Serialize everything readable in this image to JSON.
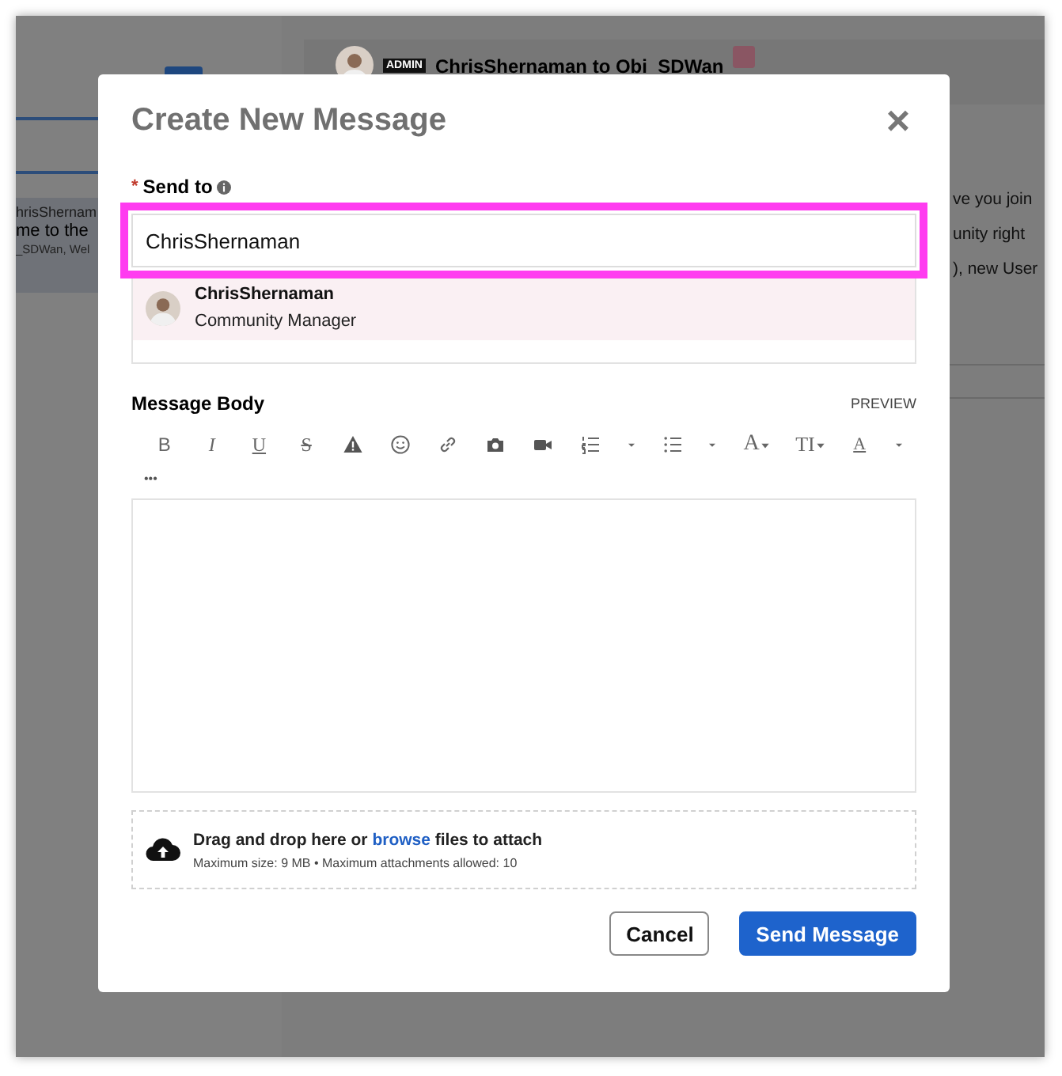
{
  "background": {
    "left_panel": {
      "row_lines": [
        "hrisShernam",
        "me to the",
        "_SDWan, Wel"
      ]
    },
    "conversation": {
      "badge": "ADMIN",
      "title": "ChrisShernaman to Obi_SDWan",
      "body_lines": [
        "ve you join",
        "unity right",
        "), new User"
      ]
    }
  },
  "dialog": {
    "title": "Create New Message",
    "close": "×",
    "send_to": {
      "label": "Send to",
      "required_mark": "*",
      "value": "ChrisShernaman",
      "highlighted": true
    },
    "suggestions": [
      {
        "name": "ChrisShernaman",
        "role": "Community Manager",
        "selected": true
      }
    ],
    "message_body": {
      "label": "Message Body",
      "preview": "PREVIEW",
      "more": "•••",
      "toolbar": [
        {
          "kind": "bold",
          "label": "B"
        },
        {
          "kind": "italic",
          "label": "I"
        },
        {
          "kind": "underline",
          "label": "U"
        },
        {
          "kind": "strike",
          "label": "S"
        },
        {
          "kind": "warning"
        },
        {
          "kind": "emoji"
        },
        {
          "kind": "link"
        },
        {
          "kind": "camera"
        },
        {
          "kind": "video"
        },
        {
          "kind": "ordered-list"
        },
        {
          "kind": "caret"
        },
        {
          "kind": "bullet-list"
        },
        {
          "kind": "caret"
        },
        {
          "kind": "font",
          "label": "A"
        },
        {
          "kind": "size",
          "label": "TI"
        },
        {
          "kind": "color",
          "label": "A"
        },
        {
          "kind": "caret"
        }
      ]
    },
    "attach": {
      "link": "browse",
      "before": "Drag and drop here or ",
      "after": " files to attach",
      "hint": "Maximum size: 9 MB • Maximum attachments allowed: 10"
    },
    "buttons": [
      {
        "label": "Cancel",
        "kind": "secondary"
      },
      {
        "label": "Send Message",
        "kind": "primary"
      }
    ]
  }
}
